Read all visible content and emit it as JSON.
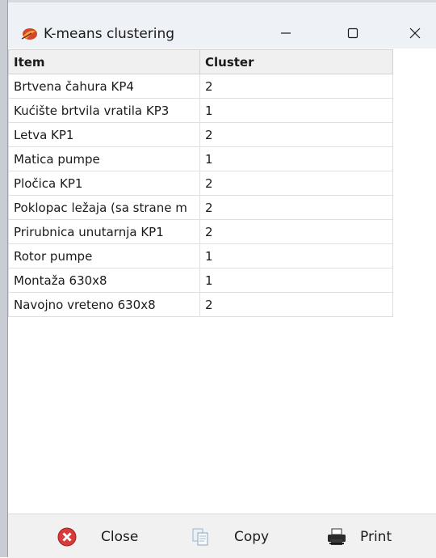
{
  "window": {
    "title": "K-means clustering",
    "icon": "app-leaf-icon",
    "controls": [
      "minimize-icon",
      "maximize-icon",
      "close-icon"
    ]
  },
  "table": {
    "headers": [
      "Item",
      "Cluster"
    ],
    "rows": [
      {
        "item": "Brtvena čahura KP4",
        "cluster": "2"
      },
      {
        "item": "Kućište brtvila vratila KP3",
        "cluster": "1"
      },
      {
        "item": "Letva KP1",
        "cluster": "2"
      },
      {
        "item": "Matica pumpe",
        "cluster": "1"
      },
      {
        "item": "Pločica KP1",
        "cluster": "2"
      },
      {
        "item": "Poklopac ležaja (sa strane m",
        "cluster": "2"
      },
      {
        "item": "Prirubnica unutarnja KP1",
        "cluster": "2"
      },
      {
        "item": "Rotor pumpe",
        "cluster": "1"
      },
      {
        "item": "Montaža 630x8",
        "cluster": "1"
      },
      {
        "item": "Navojno vreteno 630x8",
        "cluster": "2"
      }
    ]
  },
  "toolbar": {
    "close_label": "Close",
    "copy_label": "Copy",
    "print_label": "Print"
  },
  "colors": {
    "titlebar": "#eef1f6",
    "header_bg": "#f0f0f0",
    "grid_line": "#dcdfe4",
    "bottom_bar": "#f1f1f1",
    "close_red": "#d83b3b"
  }
}
